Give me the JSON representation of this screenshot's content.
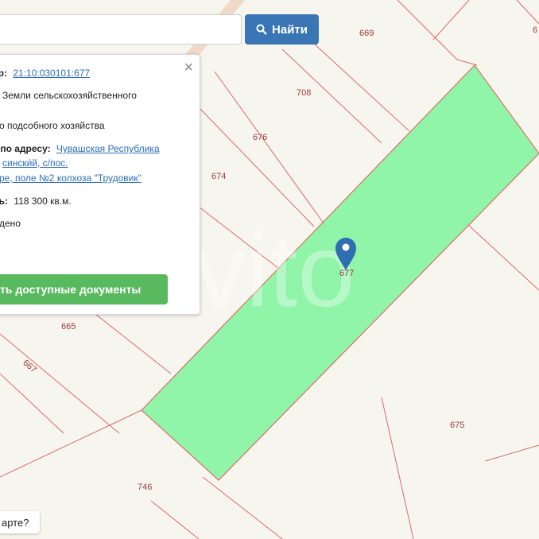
{
  "search": {
    "value": "",
    "button_label": "Найти"
  },
  "parcels": [
    {
      "label": "669"
    },
    {
      "label": "708"
    },
    {
      "label": "676"
    },
    {
      "label": "674"
    },
    {
      "label": "677"
    },
    {
      "label": "665"
    },
    {
      "label": "667"
    },
    {
      "label": "675"
    },
    {
      "label": "746"
    },
    {
      "label": "6"
    }
  ],
  "popup": {
    "cadastral_prefix": "ер:",
    "cadastral_number": "21:10:030101:677",
    "category": "Земли сельскохозяйственного",
    "usage": "о подсобного хозяйства",
    "address_label": "к по адресу:",
    "address_line1": "Чувашская Республика",
    "address_line2": "сински́й, с/пос.",
    "address_line3": "ре, поле №2 колхоза \"Трудовик\"",
    "area_label": "дь:",
    "area_value": "118 300 кв.м.",
    "status": "дено"
  },
  "docs_button_label": "ть доступные документы",
  "bottom_chip_label": "арте?",
  "watermark": "Avito",
  "colors": {
    "parcel_fill": "#7ef39c",
    "parcel_border": "#e05a5a",
    "marker": "#2f6fb0",
    "button": "#3a76b5",
    "docs_button": "#58b95e"
  }
}
